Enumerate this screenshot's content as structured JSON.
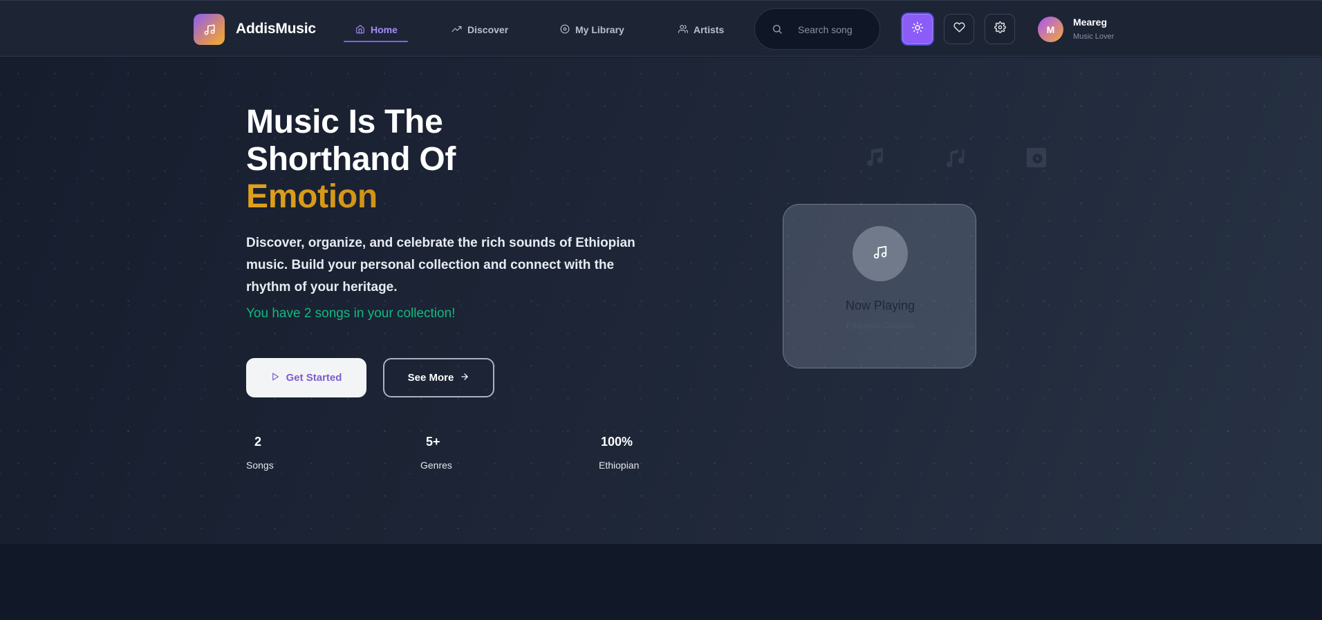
{
  "brand": {
    "name": "AddisMusic",
    "logo_icon": "music-note-icon"
  },
  "nav": {
    "items": [
      {
        "label": "Home",
        "icon": "home-icon",
        "active": true
      },
      {
        "label": "Discover",
        "icon": "trending-icon",
        "active": false
      },
      {
        "label": "My Library",
        "icon": "disc-icon",
        "active": false
      },
      {
        "label": "Artists",
        "icon": "users-icon",
        "active": false
      }
    ]
  },
  "search": {
    "placeholder": "Search song",
    "value": ""
  },
  "toolbar": {
    "theme_icon": "sun-icon",
    "favorites_icon": "heart-icon",
    "settings_icon": "gear-icon"
  },
  "user": {
    "initial": "M",
    "name": "Meareg",
    "role": "Music Lover"
  },
  "hero": {
    "headline_line1": "Music Is The",
    "headline_line2": "Shorthand Of",
    "headline_accent": "Emotion",
    "description": "Discover, organize, and celebrate the rich sounds of Ethiopian music. Build your personal collection and connect with the rhythm of your heritage.",
    "collection_message": "You have 2 songs in your collection!",
    "primary_button": "Get Started",
    "secondary_button": "See More"
  },
  "stats": [
    {
      "value": "2",
      "label": "Songs"
    },
    {
      "value": "5+",
      "label": "Genres"
    },
    {
      "value": "100%",
      "label": "Ethiopian"
    }
  ],
  "now_playing": {
    "title": "Now Playing",
    "subtitle": "Ethiopian Classics",
    "icon": "music-note-icon"
  },
  "colors": {
    "accent": "#8b5cf6",
    "highlight": "#dd9f1d",
    "success": "#10b981",
    "background": "#111827"
  }
}
